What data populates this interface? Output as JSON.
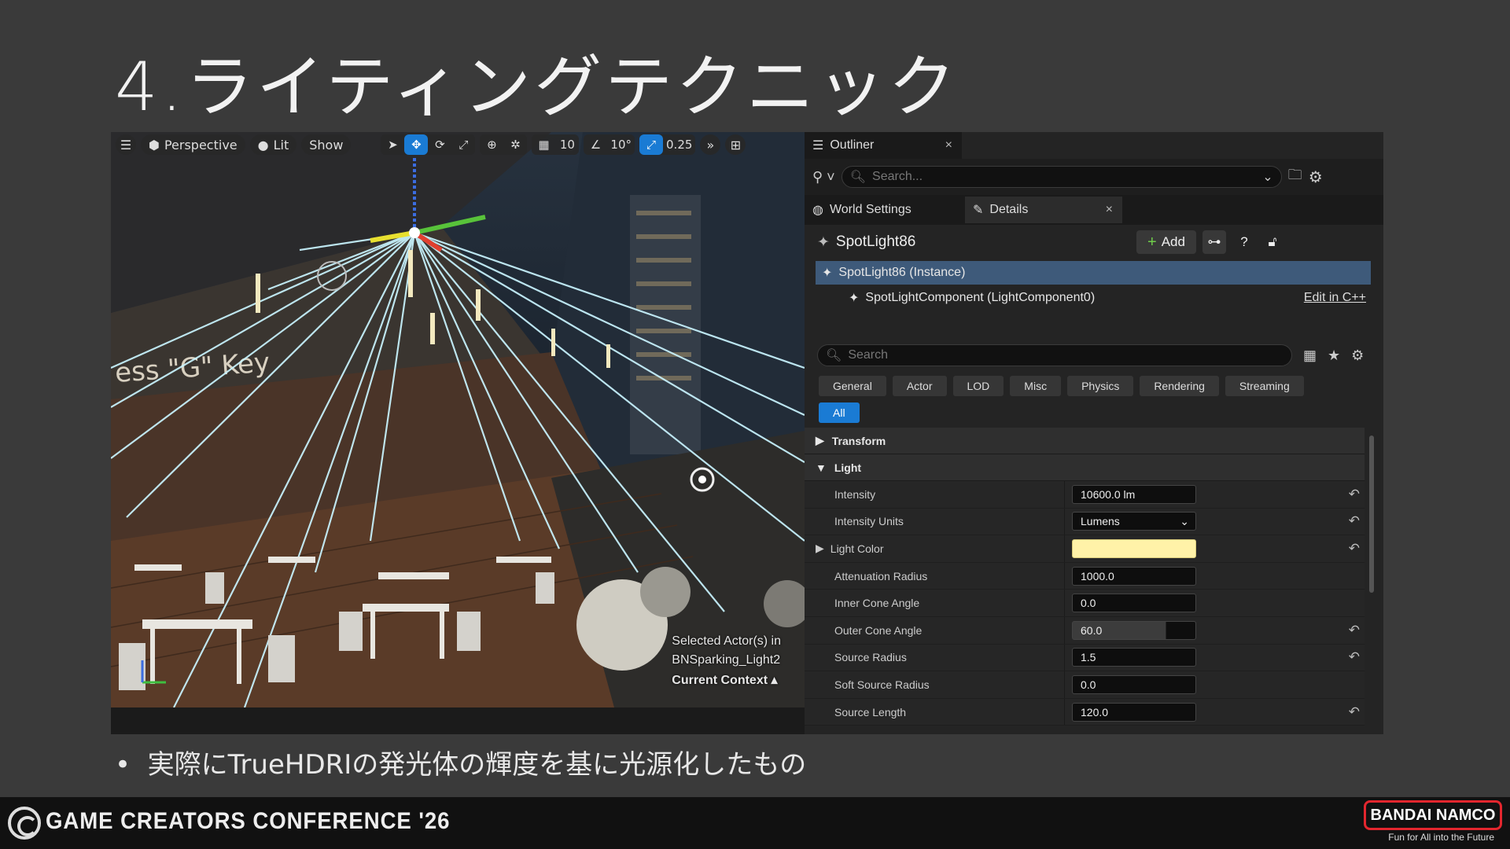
{
  "slide": {
    "title": "4.ライティングテクニック",
    "bullet": "実際にTrueHDRIの発光体の輝度を基に光源化したもの"
  },
  "viewport": {
    "menu_icon": "hamburger-icon",
    "perspective_label": "Perspective",
    "lit_label": "Lit",
    "show_label": "Show",
    "grid_snap": "10",
    "rotation_snap": "10°",
    "scale_snap": "0.25",
    "sign_text": "ess \"G\" Key",
    "overlay_line1": "Selected Actor(s) in",
    "overlay_line2": "BNSparking_Light2",
    "current_context": "Current Context"
  },
  "outliner": {
    "tab_label": "Outliner",
    "search_placeholder": "Search..."
  },
  "details": {
    "world_settings_tab": "World Settings",
    "details_tab": "Details",
    "actor_name": "SpotLight86",
    "add_label": "Add",
    "instance_label": "SpotLight86 (Instance)",
    "component_label": "SpotLightComponent (LightComponent0)",
    "edit_cpp": "Edit in C++",
    "search_placeholder": "Search",
    "categories": [
      "General",
      "Actor",
      "LOD",
      "Misc",
      "Physics",
      "Rendering",
      "Streaming"
    ],
    "all_label": "All",
    "sections": {
      "transform": "Transform",
      "light": "Light"
    },
    "properties": [
      {
        "label": "Intensity",
        "value": "10600.0 lm"
      },
      {
        "label": "Intensity Units",
        "value": "Lumens"
      },
      {
        "label": "Light Color",
        "value": ""
      },
      {
        "label": "Attenuation Radius",
        "value": "1000.0"
      },
      {
        "label": "Inner Cone Angle",
        "value": "0.0"
      },
      {
        "label": "Outer Cone Angle",
        "value": "60.0"
      },
      {
        "label": "Source Radius",
        "value": "1.5"
      },
      {
        "label": "Soft Source Radius",
        "value": "0.0"
      },
      {
        "label": "Source Length",
        "value": "120.0"
      }
    ],
    "light_color_hex": "#fff2a8"
  },
  "footer": {
    "conference": "GAME CREATORS CONFERENCE '26",
    "company": "BANDAI NAMCO",
    "tagline": "Fun for All into the Future"
  },
  "colors": {
    "accent": "#1a7bd4",
    "selection": "#3e5a7a",
    "brand_red": "#e3262e"
  }
}
